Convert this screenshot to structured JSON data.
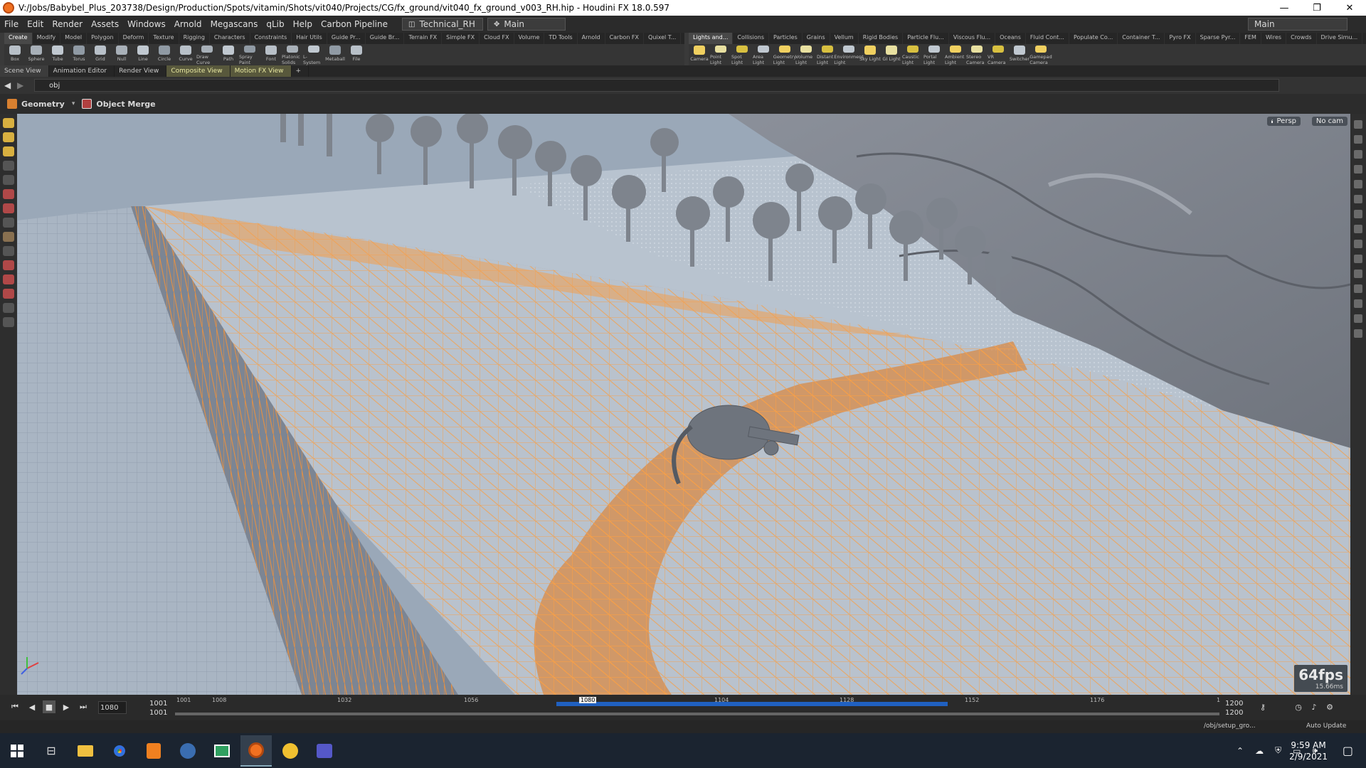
{
  "window": {
    "title": "V:/Jobs/Babybel_Plus_203738/Design/Production/Spots/vitamin/Shots/vit040/Projects/CG/fx_ground/vit040_fx_ground_v003_RH.hip - Houdini FX 18.0.597",
    "minimize": "—",
    "maximize": "❐",
    "close": "✕"
  },
  "menu": {
    "items": [
      "File",
      "Edit",
      "Render",
      "Assets",
      "Windows",
      "Arnold",
      "Megascans",
      "qLib",
      "Help",
      "Carbon Pipeline"
    ],
    "desktop": "Technical_RH",
    "desktop_icon": "layout-icon",
    "context": "Main",
    "right_desktop": "Main"
  },
  "shelf_left": {
    "tabs": [
      "Create",
      "Modify",
      "Model",
      "Polygon",
      "Deform",
      "Texture",
      "Rigging",
      "Characters",
      "Constraints",
      "Hair Utils",
      "Guide Pr...",
      "Guide Br...",
      "Terrain FX",
      "Simple FX",
      "Cloud FX",
      "Volume",
      "TD Tools",
      "Arnold",
      "Carbon FX",
      "Quixel T..."
    ],
    "tools": [
      "Box",
      "Sphere",
      "Tube",
      "Torus",
      "Grid",
      "Null",
      "Line",
      "Circle",
      "Curve",
      "Draw Curve",
      "Path",
      "Spray Paint",
      "Font",
      "Platonic Solids",
      "L-System",
      "Metaball",
      "File"
    ]
  },
  "shelf_right": {
    "tabs": [
      "Lights and...",
      "Collisions",
      "Particles",
      "Grains",
      "Vellum",
      "Rigid Bodies",
      "Particle Flu...",
      "Viscous Flu...",
      "Oceans",
      "Fluid Cont...",
      "Populate Co...",
      "Container T...",
      "Pyro FX",
      "Sparse Pyr...",
      "FEM",
      "Wires",
      "Crowds",
      "Drive Simu..."
    ],
    "tools": [
      "Camera",
      "Point Light",
      "Spot Light",
      "Area Light",
      "Geometry Light",
      "Volume Light",
      "Distant Light",
      "Environment Light",
      "Sky Light",
      "GI Light",
      "Caustic Light",
      "Portal Light",
      "Ambient Light",
      "Stereo Camera",
      "VR Camera",
      "Switcher",
      "Gamepad Camera"
    ]
  },
  "panes": {
    "tabs": [
      "Scene View",
      "Animation Editor",
      "Render View",
      "Composite View",
      "Motion FX View"
    ],
    "add": "+"
  },
  "path": {
    "value": "obj"
  },
  "operator": {
    "state": "Geometry",
    "node": "Object Merge"
  },
  "viewport": {
    "projection": "Persp",
    "camera": "No cam",
    "fps": "64fps",
    "frame_time": "15.66ms",
    "wire_color": "#f5a04a",
    "ground_color": "#b7c1cd"
  },
  "timeline": {
    "current_frame": "1080",
    "start": "1001",
    "start2": "1001",
    "end": "1200",
    "end2": "1200",
    "ticks": [
      "1001",
      "1008",
      "1032",
      "1056",
      "1080",
      "1104",
      "1128",
      "1152",
      "1176",
      "1"
    ]
  },
  "status": {
    "path": "/obj/setup_gro...",
    "update": "Auto Update"
  },
  "taskbar": {
    "time": "9:59 AM",
    "date": "2/9/2021"
  }
}
